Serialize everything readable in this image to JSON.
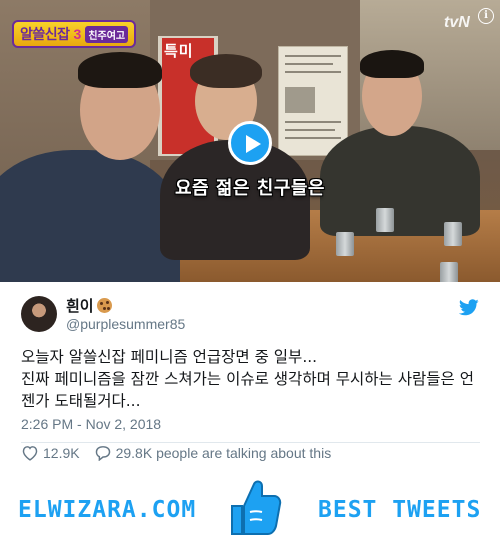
{
  "media": {
    "show_logo_name": "알쓸신잡",
    "show_logo_number": "3",
    "show_logo_sub": "친주여고",
    "poster_text": "특미",
    "channel": "tvN",
    "subtitle": "요즘 젊은 친구들은",
    "info_icon": "i"
  },
  "tweet": {
    "display_name": "흰이",
    "handle": "@purplesummer85",
    "text": "오늘자 알쓸신잡 페미니즘 언급장면 중 일부...\n진짜 페미니즘을 잠깐 스쳐가는 이슈로 생각하며 무시하는 사람들은 언젠가 도태될거다...",
    "timestamp": "2:26 PM - Nov 2, 2018",
    "likes": "12.9K",
    "talking": "29.8K people are talking about this"
  },
  "footer": {
    "brand": "ELWIZARA.COM",
    "tagline": "BEST TWEETS"
  },
  "colors": {
    "twitter_blue": "#1da1f2",
    "muted_text": "#657786"
  },
  "icons": {
    "play": "play-icon",
    "bird": "twitter-bird-icon",
    "like": "heart-icon",
    "reply": "speech-bubble-icon",
    "thumb": "thumbs-up-icon",
    "cookie": "cookie-emoji-icon"
  }
}
